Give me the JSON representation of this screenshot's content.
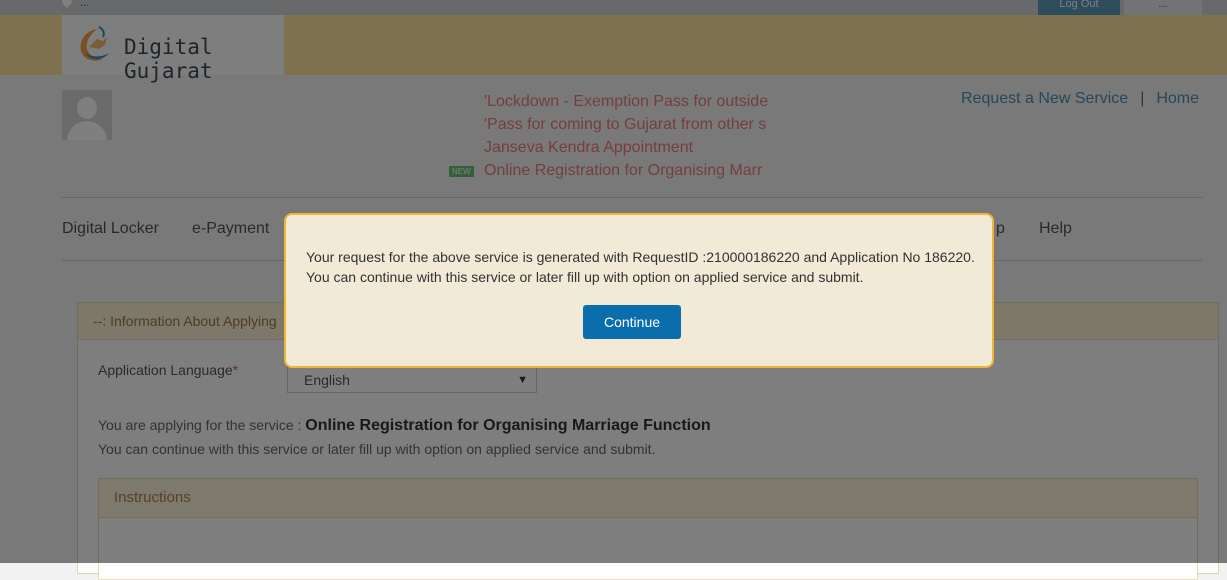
{
  "topbar": {
    "language": "...",
    "logout_label": "Log Out",
    "user_label": "..."
  },
  "header": {
    "site_name": "Digital Gujarat"
  },
  "news": {
    "items": [
      "'Lockdown - Exemption Pass for outside",
      "'Pass for coming to Gujarat from other s",
      "Janseva Kendra Appointment",
      "Online Registration for Organising Marr"
    ],
    "new_badge": "NEW"
  },
  "top_links": {
    "request_new": "Request a New Service",
    "separator": "|",
    "home": "Home"
  },
  "nav": {
    "items": [
      "Digital Locker",
      "e-Payment",
      "p",
      "Help"
    ]
  },
  "panel": {
    "title": "--: Information About Applying",
    "language_label": "Application Language",
    "required_mark": "*",
    "language_value": "English",
    "service_prefix": "You are applying for the service :",
    "service_name": "Online Registration for Organising Marriage Function",
    "continue_note": "You can continue with this service or later fill up with option on applied service and submit.",
    "instructions_title": "Instructions"
  },
  "modal": {
    "line1": "Your request for the above service is generated with RequestID :210000186220 and Application No 186220.",
    "line2": "You can continue with this service or later fill up with option on applied service and submit.",
    "button": "Continue"
  },
  "colors": {
    "accent_button": "#0a6eac",
    "modal_border": "#efb631",
    "news_text": "#ea7c7c",
    "link": "#4f8fba"
  },
  "icons": {
    "logo": "digital-gujarat-logo-icon",
    "avatar": "user-avatar-icon",
    "location": "location-pin-icon",
    "dropdown": "chevron-down-icon"
  }
}
